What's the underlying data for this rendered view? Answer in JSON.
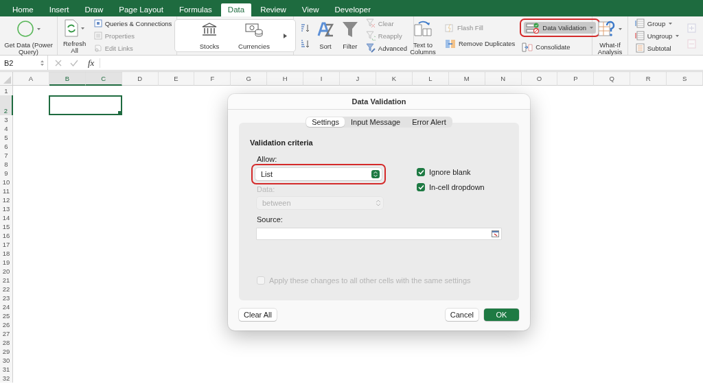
{
  "tabs": [
    {
      "label": "Home",
      "selected": false
    },
    {
      "label": "Insert",
      "selected": false
    },
    {
      "label": "Draw",
      "selected": false
    },
    {
      "label": "Page Layout",
      "selected": false
    },
    {
      "label": "Formulas",
      "selected": false
    },
    {
      "label": "Data",
      "selected": true
    },
    {
      "label": "Review",
      "selected": false
    },
    {
      "label": "View",
      "selected": false
    },
    {
      "label": "Developer",
      "selected": false
    }
  ],
  "ribbon": [
    {
      "kind": "get_data",
      "items": [
        {
          "label": "Get Data (Power Query)",
          "disabled": false
        }
      ]
    },
    {
      "kind": "queries",
      "items": [
        {
          "label": "Refresh All",
          "disabled": false
        },
        {
          "label": "Queries & Connections",
          "disabled": false
        },
        {
          "label": "Properties",
          "disabled": true
        },
        {
          "label": "Edit Links",
          "disabled": true
        }
      ]
    },
    {
      "kind": "data_types",
      "items": [
        {
          "label": "Stocks",
          "disabled": false
        },
        {
          "label": "Currencies",
          "disabled": false
        }
      ]
    },
    {
      "kind": "sort_filter",
      "items": [
        {
          "label": "Sort",
          "disabled": false
        },
        {
          "label": "Filter",
          "disabled": false
        },
        {
          "label": "Clear",
          "disabled": true
        },
        {
          "label": "Reapply",
          "disabled": true
        },
        {
          "label": "Advanced",
          "disabled": false
        }
      ]
    },
    {
      "kind": "data_tools",
      "items": [
        {
          "label": "Flash Fill",
          "disabled": true
        },
        {
          "label": "Data Validation",
          "disabled": false,
          "pressed": true,
          "highlighted": true
        },
        {
          "label": "Text to Columns",
          "disabled": false
        },
        {
          "label": "Remove Duplicates",
          "disabled": false
        },
        {
          "label": "Consolidate",
          "disabled": false
        }
      ]
    },
    {
      "kind": "forecast",
      "items": [
        {
          "label": "What-If Analysis",
          "disabled": false
        }
      ]
    },
    {
      "kind": "outline",
      "items": [
        {
          "label": "Group",
          "disabled": false
        },
        {
          "label": "Ungroup",
          "disabled": false
        },
        {
          "label": "Subtotal",
          "disabled": false
        }
      ]
    }
  ],
  "formula_bar": {
    "name_box": "B2",
    "function_label": "fx"
  },
  "sheet": {
    "columns": [
      {
        "label": "A",
        "selected": false
      },
      {
        "label": "B",
        "selected": true
      },
      {
        "label": "C",
        "selected": true
      },
      {
        "label": "D",
        "selected": false
      },
      {
        "label": "E",
        "selected": false
      },
      {
        "label": "F",
        "selected": false
      },
      {
        "label": "G",
        "selected": false
      },
      {
        "label": "H",
        "selected": false
      },
      {
        "label": "I",
        "selected": false
      },
      {
        "label": "J",
        "selected": false
      },
      {
        "label": "K",
        "selected": false
      },
      {
        "label": "L",
        "selected": false
      },
      {
        "label": "M",
        "selected": false
      },
      {
        "label": "N",
        "selected": false
      },
      {
        "label": "O",
        "selected": false
      },
      {
        "label": "P",
        "selected": false
      },
      {
        "label": "Q",
        "selected": false
      },
      {
        "label": "R",
        "selected": false
      },
      {
        "label": "S",
        "selected": false
      }
    ],
    "rows": [
      {
        "label": "1",
        "selected": false
      },
      {
        "label": "2",
        "selected": true
      },
      {
        "label": "3",
        "selected": false
      },
      {
        "label": "4",
        "selected": false
      },
      {
        "label": "5",
        "selected": false
      },
      {
        "label": "6",
        "selected": false
      },
      {
        "label": "7",
        "selected": false
      },
      {
        "label": "8",
        "selected": false
      },
      {
        "label": "9",
        "selected": false
      },
      {
        "label": "10",
        "selected": false
      },
      {
        "label": "11",
        "selected": false
      },
      {
        "label": "12",
        "selected": false
      },
      {
        "label": "13",
        "selected": false
      },
      {
        "label": "14",
        "selected": false
      },
      {
        "label": "15",
        "selected": false
      },
      {
        "label": "16",
        "selected": false
      },
      {
        "label": "17",
        "selected": false
      },
      {
        "label": "18",
        "selected": false
      },
      {
        "label": "19",
        "selected": false
      },
      {
        "label": "20",
        "selected": false
      },
      {
        "label": "21",
        "selected": false
      },
      {
        "label": "22",
        "selected": false
      },
      {
        "label": "23",
        "selected": false
      },
      {
        "label": "24",
        "selected": false
      },
      {
        "label": "25",
        "selected": false
      },
      {
        "label": "26",
        "selected": false
      },
      {
        "label": "27",
        "selected": false
      },
      {
        "label": "28",
        "selected": false
      },
      {
        "label": "29",
        "selected": false
      },
      {
        "label": "30",
        "selected": false
      },
      {
        "label": "31",
        "selected": false
      },
      {
        "label": "32",
        "selected": false
      }
    ]
  },
  "dialog": {
    "title": "Data Validation",
    "tabs": [
      {
        "label": "Settings",
        "selected": true
      },
      {
        "label": "Input Message",
        "selected": false
      },
      {
        "label": "Error Alert",
        "selected": false
      }
    ],
    "section_title": "Validation criteria",
    "allow": {
      "label": "Allow:",
      "value": "List",
      "disabled": false,
      "highlighted": true
    },
    "data": {
      "label": "Data:",
      "value": "between",
      "disabled": true
    },
    "checkboxes": [
      {
        "label": "Ignore blank",
        "checked": true,
        "disabled": false
      },
      {
        "label": "In-cell dropdown",
        "checked": true,
        "disabled": false
      }
    ],
    "source": {
      "label": "Source:"
    },
    "apply_all": {
      "label": "Apply these changes to all other cells with the same settings",
      "checked": false,
      "disabled": true
    },
    "buttons": [
      {
        "label": "Clear All",
        "kind": "plain"
      },
      {
        "label": "Cancel",
        "kind": "plain"
      },
      {
        "label": "OK",
        "kind": "default"
      }
    ]
  }
}
